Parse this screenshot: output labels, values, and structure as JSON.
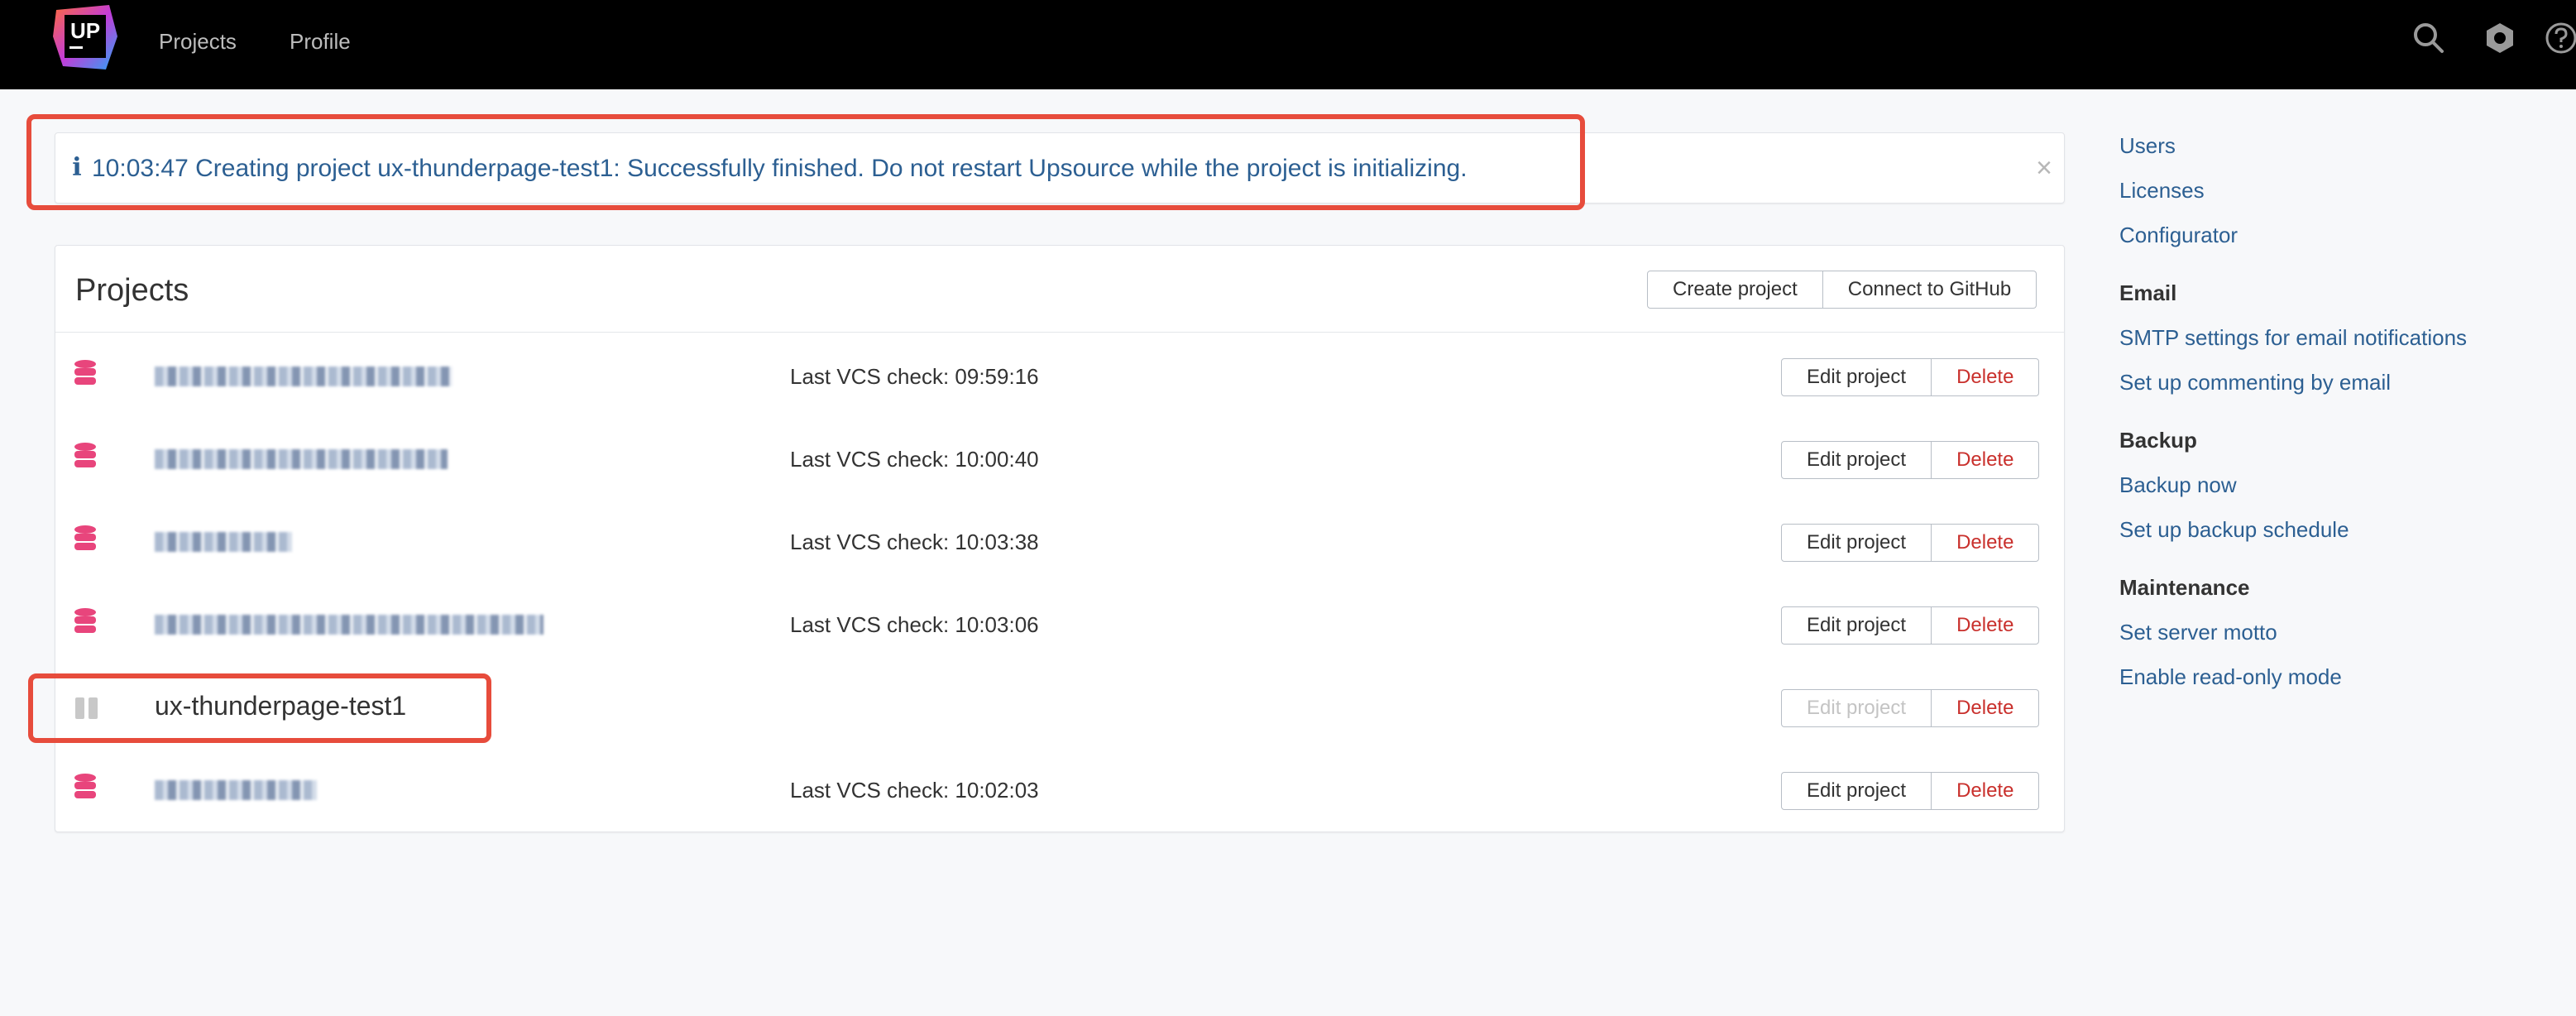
{
  "topbar": {
    "logo_text": "UP",
    "nav": [
      {
        "label": "Projects"
      },
      {
        "label": "Profile"
      }
    ],
    "icons": [
      "search-icon",
      "gear-icon",
      "help-icon"
    ]
  },
  "notice": {
    "icon": "info-icon",
    "icon_glyph": "i",
    "text": "10:03:47 Creating project ux-thunderpage-test1: Successfully finished. Do not restart Upsource while the project is initializing.",
    "close_glyph": "×"
  },
  "projects": {
    "title": "Projects",
    "create_label": "Create project",
    "github_label": "Connect to GitHub",
    "edit_label": "Edit project",
    "delete_label": "Delete",
    "rows": [
      {
        "name": "",
        "vcs": "Last VCS check: 09:59:16",
        "status": "ready",
        "edit_enabled": true
      },
      {
        "name": "",
        "vcs": "Last VCS check: 10:00:40",
        "status": "ready",
        "edit_enabled": true
      },
      {
        "name": "",
        "vcs": "Last VCS check: 10:03:38",
        "status": "ready",
        "edit_enabled": true
      },
      {
        "name": "",
        "vcs": "Last VCS check: 10:03:06",
        "status": "ready",
        "edit_enabled": true
      },
      {
        "name": "ux-thunderpage-test1",
        "vcs": "",
        "status": "paused",
        "edit_enabled": false
      },
      {
        "name": "",
        "vcs": "Last VCS check: 10:02:03",
        "status": "ready",
        "edit_enabled": true
      }
    ]
  },
  "sidebar": {
    "links_top": [
      "Users",
      "Licenses",
      "Configurator"
    ],
    "email_heading": "Email",
    "email_links": [
      "SMTP settings for email notifications",
      "Set up commenting by email"
    ],
    "backup_heading": "Backup",
    "backup_links": [
      "Backup now",
      "Set up backup schedule"
    ],
    "maintenance_heading": "Maintenance",
    "maintenance_links": [
      "Set server motto",
      "Enable read-only mode"
    ]
  },
  "colors": {
    "accent": "#2c5f92",
    "db_icon": "#e8457c",
    "delete": "#c9302c",
    "highlight": "#e74c3c"
  }
}
